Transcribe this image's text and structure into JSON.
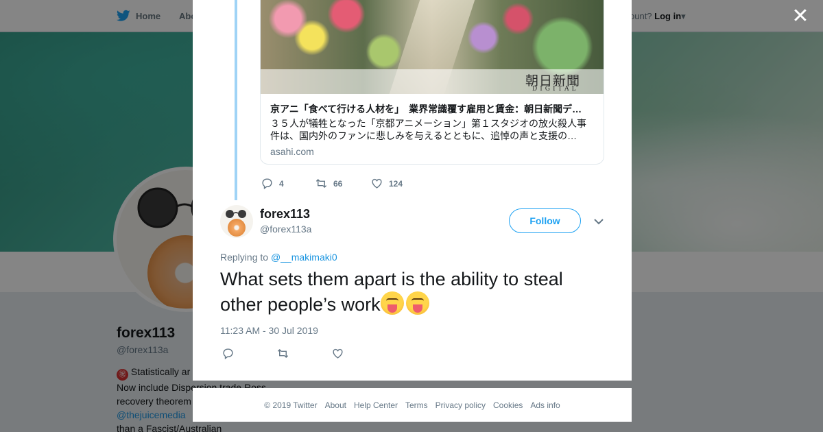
{
  "topbar": {
    "home_label": "Home",
    "about_label": "Abo",
    "login_prefix": "ccount?",
    "login_label": "Log in"
  },
  "profile": {
    "name": "forex113",
    "handle": "@forex113a",
    "bio_line1": "Statistically ar",
    "bio_line2": "Now include Dispersion trade Ross",
    "bio_line3": "recovery theorem",
    "bio_mention": "@thejuicemedia",
    "bio_line5": "than a Fascist/Australian"
  },
  "link_card": {
    "image_watermark": "朝日新聞",
    "image_watermark_sub": "DIGITAL",
    "title": "京アニ「食べて行ける人材を」　業界常識覆す雇用と賃金：朝日新聞デ…",
    "description": "３５人が犠牲となった「京都アニメーション」第１スタジオの放火殺人事件は、国内外のファンに悲しみを与えるとともに、追悼の声と支援の…",
    "domain": "asahi.com"
  },
  "parent_tweet_actions": {
    "replies": "4",
    "retweets": "66",
    "likes": "124"
  },
  "tweet": {
    "author_name": "forex113",
    "author_handle": "@forex113a",
    "follow_label": "Follow",
    "replying_prefix": "Replying to",
    "replying_to": "@__makimaki0",
    "text": "What sets them apart is the ability to steal other people’s work",
    "timestamp": "11:23 AM - 30 Jul 2019"
  },
  "footer": {
    "copyright": "© 2019 Twitter",
    "links": [
      "About",
      "Help Center",
      "Terms",
      "Privacy policy",
      "Cookies",
      "Ads info"
    ]
  },
  "icons": {
    "close": "close-icon",
    "bird": "twitter-bird-icon",
    "reply": "reply-icon",
    "retweet": "retweet-icon",
    "like": "heart-icon",
    "caret": "chevron-down-icon"
  },
  "colors": {
    "accent": "#1da1f2",
    "link": "#1b95e0",
    "muted": "#657786",
    "thread_line": "#9fd3f6"
  }
}
